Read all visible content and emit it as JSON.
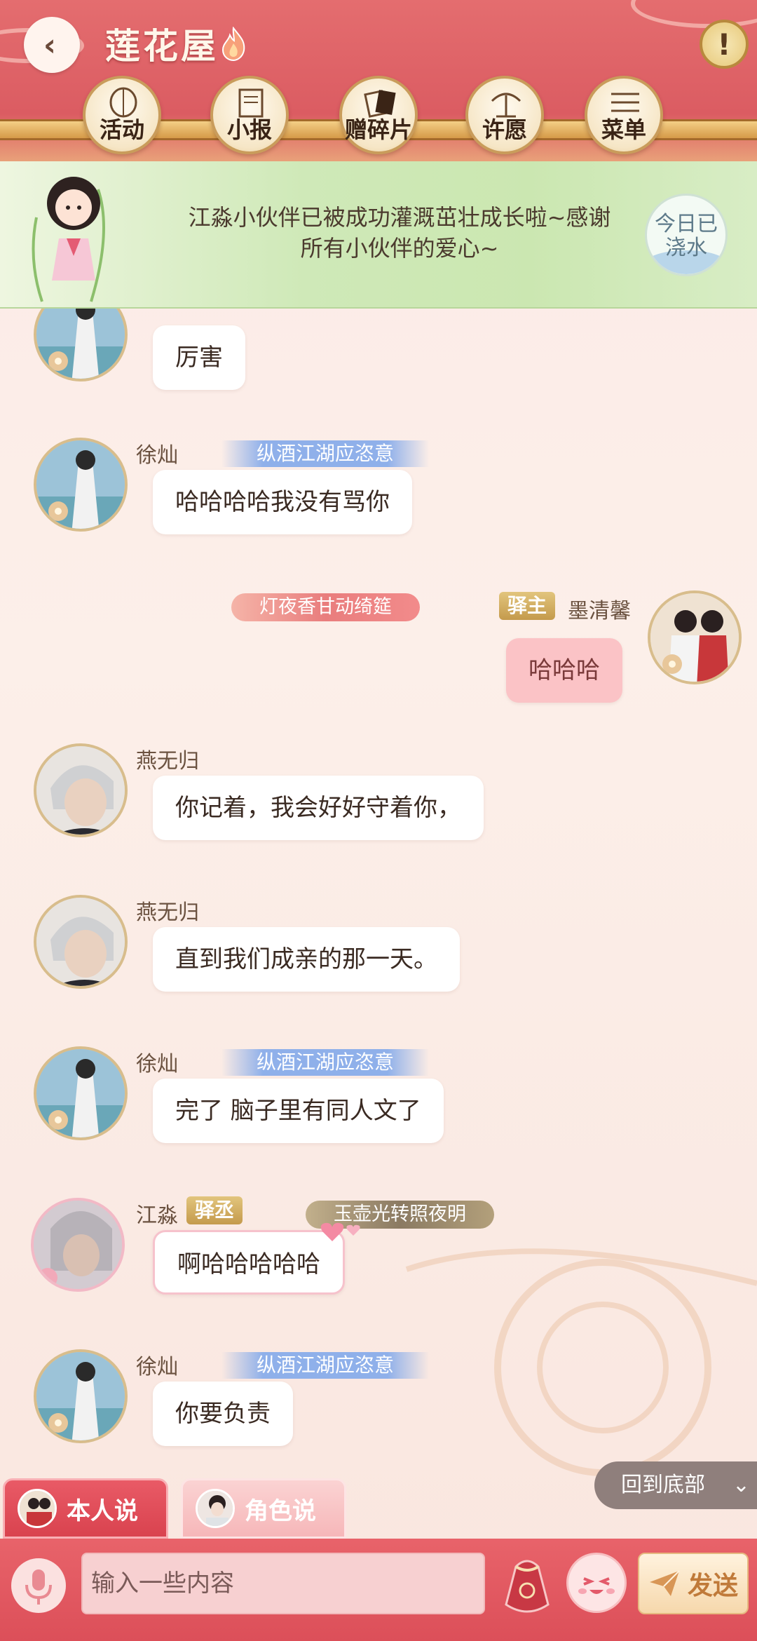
{
  "header": {
    "room_title": "莲花屋",
    "nav": [
      {
        "label": "活动",
        "icon": "lantern-icon"
      },
      {
        "label": "小报",
        "icon": "scroll-icon"
      },
      {
        "label": "赠碎片",
        "icon": "card-icon"
      },
      {
        "label": "许愿",
        "icon": "wish-tree-icon"
      },
      {
        "label": "菜单",
        "icon": "menu-icon"
      }
    ]
  },
  "banner": {
    "text_line1": "江淼小伙伴已被成功灌溉茁壮成长啦~感谢",
    "text_line2": "所有小伙伴的爱心~",
    "badge_line1": "今日已",
    "badge_line2": "浇水"
  },
  "messages": [
    {
      "user": "",
      "title": "",
      "text": "厉害"
    },
    {
      "user": "徐灿",
      "title": "纵酒江湖应恣意",
      "text": "哈哈哈哈我没有骂你"
    },
    {
      "user": "墨清馨",
      "role": "驿主",
      "deco_title": "灯夜香甘动绮筵",
      "text": "哈哈哈"
    },
    {
      "user": "燕无归",
      "text": "你记着，我会好好守着你，"
    },
    {
      "user": "燕无归",
      "text": "直到我们成亲的那一天。"
    },
    {
      "user": "徐灿",
      "title": "纵酒江湖应恣意",
      "text": "完了 脑子里有同人文了"
    },
    {
      "user": "江淼",
      "role": "驿丞",
      "deco_title": "玉壶光转照夜明",
      "text": "啊哈哈哈哈哈"
    },
    {
      "user": "徐灿",
      "title": "纵酒江湖应恣意",
      "text": "你要负责"
    }
  ],
  "bottom": {
    "back_to_bottom": "回到底部",
    "tab_self": "本人说",
    "tab_role": "角色说",
    "input_placeholder": "输入一些内容",
    "send_label": "发送"
  },
  "colors": {
    "header_red": "#db5c62",
    "banner_green": "#cfe9b8",
    "tag_blue": "#8fb0ea",
    "badge_gold": "#c49a4c",
    "pink_bubble": "#fbc3c6"
  }
}
